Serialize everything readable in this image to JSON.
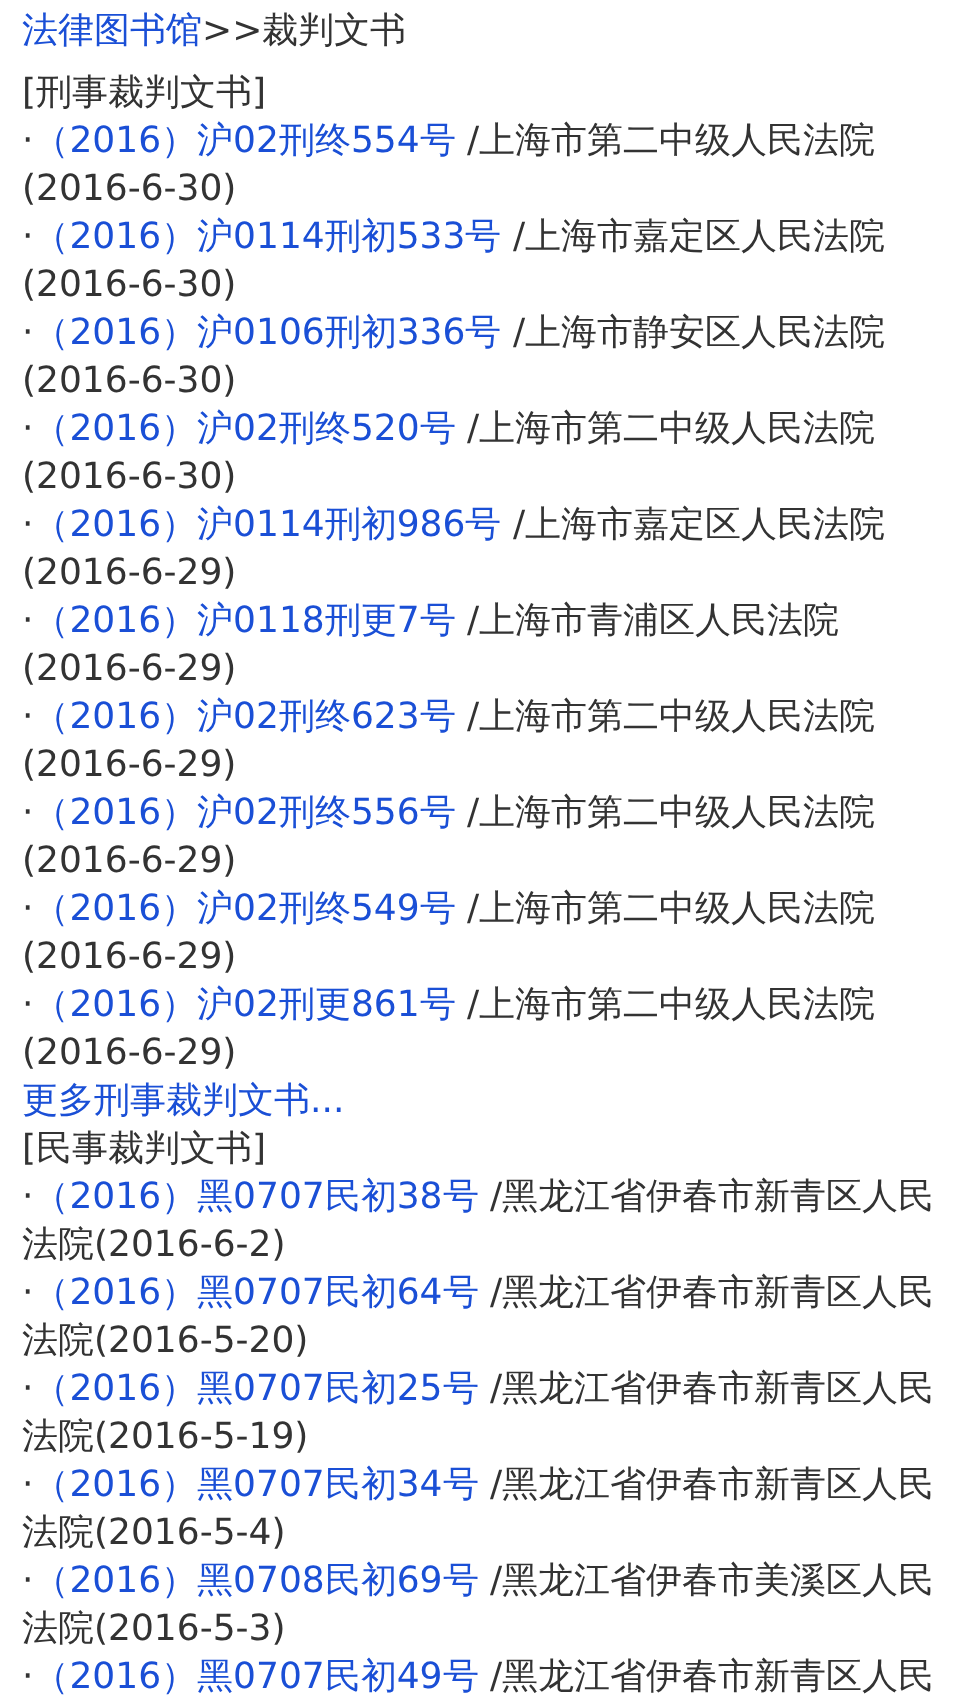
{
  "breadcrumb": {
    "home": "法律图书馆",
    "current": ">>裁判文书"
  },
  "sections": [
    {
      "heading": "[刑事裁判文书]",
      "bullet": "·",
      "items": [
        {
          "case": "（2016）沪02刑终554号",
          "court": " /上海市第二中级人民法院",
          "date": "(2016-6-30)"
        },
        {
          "case": "（2016）沪0114刑初533号",
          "court": " /上海市嘉定区人民法院",
          "date": "(2016-6-30)"
        },
        {
          "case": "（2016）沪0106刑初336号",
          "court": " /上海市静安区人民法院",
          "date": "(2016-6-30)"
        },
        {
          "case": "（2016）沪02刑终520号",
          "court": " /上海市第二中级人民法院",
          "date": "(2016-6-30)"
        },
        {
          "case": "（2016）沪0114刑初986号",
          "court": " /上海市嘉定区人民法院",
          "date": "(2016-6-29)"
        },
        {
          "case": "（2016）沪0118刑更7号",
          "court": " /上海市青浦区人民法院",
          "date": "(2016-6-29)"
        },
        {
          "case": "（2016）沪02刑终623号",
          "court": " /上海市第二中级人民法院",
          "date": "(2016-6-29)"
        },
        {
          "case": "（2016）沪02刑终556号",
          "court": " /上海市第二中级人民法院",
          "date": "(2016-6-29)"
        },
        {
          "case": "（2016）沪02刑终549号",
          "court": " /上海市第二中级人民法院",
          "date": "(2016-6-29)"
        },
        {
          "case": "（2016）沪02刑更861号",
          "court": " /上海市第二中级人民法院",
          "date": "(2016-6-29)"
        }
      ],
      "more": "更多刑事裁判文书..."
    },
    {
      "heading": "[民事裁判文书]",
      "bullet": "·",
      "items": [
        {
          "case": "（2016）黑0707民初38号",
          "court": " /黑龙江省伊春市新青区人民法院",
          "date": "(2016-6-2)"
        },
        {
          "case": "（2016）黑0707民初64号",
          "court": " /黑龙江省伊春市新青区人民法院",
          "date": "(2016-5-20)"
        },
        {
          "case": "（2016）黑0707民初25号",
          "court": " /黑龙江省伊春市新青区人民法院",
          "date": "(2016-5-19)"
        },
        {
          "case": "（2016）黑0707民初34号",
          "court": " /黑龙江省伊春市新青区人民法院",
          "date": "(2016-5-4)"
        },
        {
          "case": "（2016）黑0708民初69号",
          "court": " /黑龙江省伊春市美溪区人民法院",
          "date": "(2016-5-3)"
        },
        {
          "case": "（2016）黑0707民初49号",
          "court": " /黑龙江省伊春市新青区人民"
        }
      ]
    }
  ]
}
